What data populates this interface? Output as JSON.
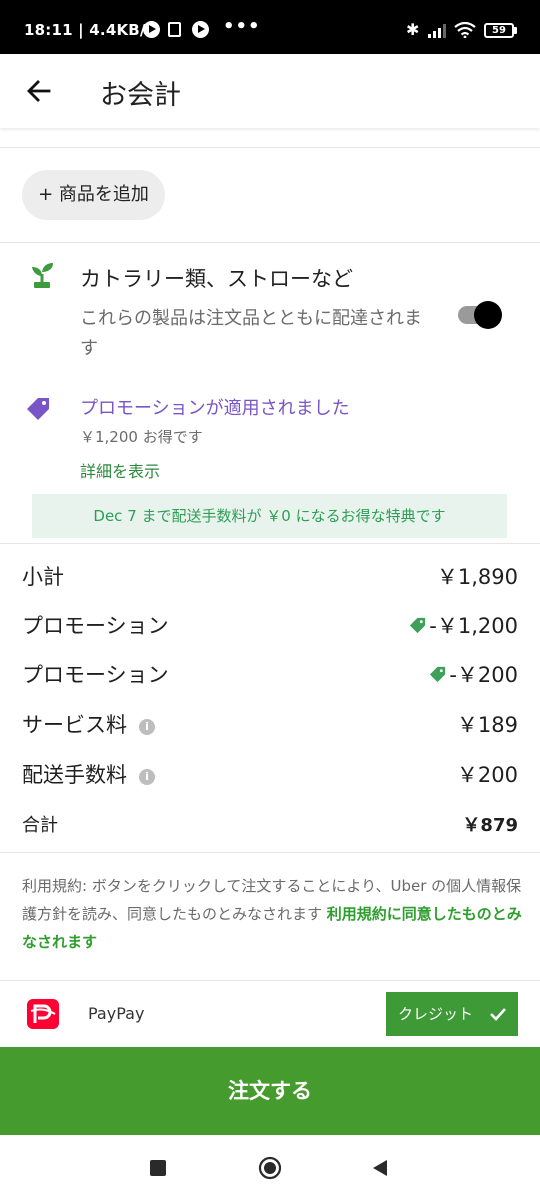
{
  "status_bar": {
    "time": "18:11",
    "speed": "4.4KB/s",
    "battery": "59"
  },
  "header": {
    "title": "お会計"
  },
  "add_item_button": "+ 商品を追加",
  "cutlery": {
    "title": "カトラリー類、ストローなど",
    "description": "これらの製品は注文品とともに配達されます",
    "toggle_on": true
  },
  "promotion": {
    "title": "プロモーションが適用されました",
    "saving": "￥1,200 お得です",
    "detail_link": "詳細を表示"
  },
  "banner": "Dec 7 まで配送手数料が ￥0 になるお得な特典です",
  "summary": {
    "subtotal_label": "小計",
    "subtotal_value": "￥1,890",
    "promo1_label": "プロモーション",
    "promo1_value": "-￥1,200",
    "promo2_label": "プロモーション",
    "promo2_value": "-￥200",
    "service_label": "サービス料",
    "service_value": "￥189",
    "delivery_label": "配送手数料",
    "delivery_value": "￥200",
    "total_label": "合計",
    "total_value": "￥879"
  },
  "terms": {
    "text": "利用規約: ボタンをクリックして注文することにより、Uber の個人情報保護方針を読み、同意したものとみなされます ",
    "link": "利用規約に同意したものとみなされます"
  },
  "payment": {
    "method": "PayPay",
    "credit_button": "クレジット"
  },
  "order_button": "注文する",
  "colors": {
    "accent_green": "#459b2e",
    "promo_purple": "#7a55c7",
    "banner_bg": "#e8f3ee"
  },
  "icons": [
    "back-arrow-icon",
    "sprout-icon",
    "tag-icon",
    "info-icon",
    "check-icon",
    "paypay-logo"
  ]
}
